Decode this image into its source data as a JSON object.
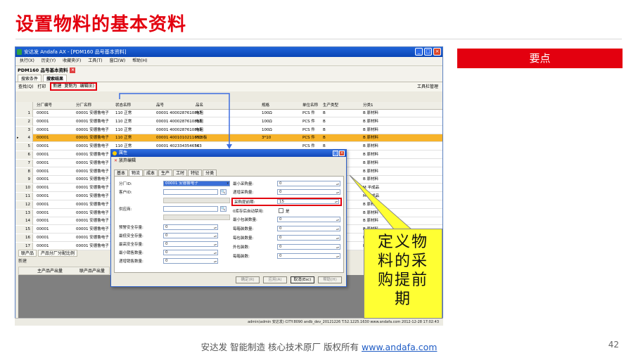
{
  "slide": {
    "title": "设置物料的基本资料",
    "key_points_label": "要点",
    "note": "定义物料的采购提前期",
    "footer_text": "安达发  智能制造 核心技术原厂   版权所有",
    "footer_link": "www.andafa.com",
    "page_number": "42"
  },
  "app": {
    "window_title": "安达发 Andafa AX - [PDM160 品号基本资料]",
    "menu": [
      "执行(X)",
      "历史(Y)",
      "收藏夹(F)",
      "工具(T)",
      "窗口(W)",
      "帮助(H)"
    ],
    "doc_title": "PDM160 品号基本资料",
    "tabs": [
      "搜索条件",
      "搜索结果"
    ],
    "toolbar": {
      "query": "查找(Q)",
      "print": "打印",
      "new": "新建",
      "copy": "复制为",
      "edit": "编辑(E)",
      "tool_manage": "工具栏管理"
    },
    "grid": {
      "columns": [
        "分厂编号",
        "分厂名称",
        "状态名称",
        "品号",
        "品名",
        "规格",
        "单位名称",
        "生产类型",
        "分类1"
      ],
      "rows": [
        [
          "1",
          "00001",
          "00001 安德鲁电子",
          "110 正常",
          "00001 4000287610857",
          "电阻",
          "100Ω",
          "PCS 件",
          "B",
          "B 原材料"
        ],
        [
          "2",
          "00001",
          "00001 安德鲁电子",
          "110 正常",
          "00001 4000287610858",
          "电阻",
          "100Ω",
          "PCS 件",
          "B",
          "B 原材料"
        ],
        [
          "3",
          "00001",
          "00001 安德鲁电子",
          "110 正常",
          "00001 4000287610859",
          "电阻",
          "100Ω",
          "PCS 件",
          "B",
          "B 原材料"
        ],
        [
          "4",
          "00001",
          "00001 安德鲁电子",
          "110 正常",
          "00001 4001010211650",
          "PCB板",
          "3*10",
          "PCS 件",
          "B",
          "B 原材料"
        ],
        [
          "5",
          "00001",
          "00001 安德鲁电子",
          "110 正常",
          "00001 4023343546543",
          "IC",
          "",
          "PCS 件",
          "B",
          "B 原材料"
        ],
        [
          "6",
          "00001",
          "00001 安德鲁电子",
          "",
          "",
          "",
          "",
          "",
          "",
          "B 原材料"
        ],
        [
          "7",
          "00001",
          "00001 安德鲁电子",
          "",
          "",
          "",
          "",
          "",
          "",
          "B 原材料"
        ],
        [
          "8",
          "00001",
          "00001 安德鲁电子",
          "",
          "",
          "",
          "",
          "",
          "",
          "B 原材料"
        ],
        [
          "9",
          "00001",
          "00001 安德鲁电子",
          "",
          "",
          "",
          "",
          "",
          "",
          "B 原材料"
        ],
        [
          "10",
          "00001",
          "00001 安德鲁电子",
          "",
          "",
          "",
          "",
          "",
          "",
          "M 半成品"
        ],
        [
          "11",
          "00001",
          "00001 安德鲁电子",
          "",
          "",
          "",
          "",
          "",
          "",
          "M 半成品"
        ],
        [
          "12",
          "00001",
          "00001 安德鲁电子",
          "",
          "",
          "",
          "",
          "",
          "",
          "B 原材料"
        ],
        [
          "13",
          "00001",
          "00001 安德鲁电子",
          "",
          "",
          "",
          "",
          "",
          "",
          "B 原材料"
        ],
        [
          "14",
          "00001",
          "00001 安德鲁电子",
          "",
          "",
          "",
          "",
          "",
          "",
          "B 原材料"
        ],
        [
          "15",
          "00001",
          "00001 安德鲁电子",
          "",
          "",
          "",
          "",
          "",
          "",
          "B 原材料"
        ],
        [
          "16",
          "00001",
          "00001 安德鲁电子",
          "",
          "",
          "",
          "",
          "",
          "",
          "B 原材料"
        ],
        [
          "17",
          "00001",
          "00001 安德鲁电子",
          "",
          "",
          "",
          "",
          "",
          "",
          "B 原材料"
        ]
      ]
    },
    "subtabs": [
      "联产品",
      "产品分厂分配比例"
    ],
    "subtoolbar": "新建",
    "subgrid_columns": [
      "主产品产出量",
      "联产品产出量"
    ],
    "statusbar": "admin(admin 安达发)  CITY:8090  andb_dev_20121226  T.52.1225.1630  www.andafa.com  2012-12-28 17:02:43"
  },
  "dialog": {
    "title": "属性",
    "toolbar_cancel": "放弃编辑",
    "tabs": [
      "基本",
      "物流",
      "成本",
      "生产",
      "工时",
      "特征",
      "分类"
    ],
    "active_tab": 1,
    "left_fields": [
      {
        "label": "分厂ID:",
        "value": "00001 安德鲁电子"
      },
      {
        "label": "客户ID:",
        "value": ""
      },
      {
        "label": "供应商:",
        "value": ""
      },
      {
        "label": "预警安全存量:",
        "value": "0"
      },
      {
        "label": "最低安全存量:",
        "value": "0"
      },
      {
        "label": "最高安全存量:",
        "value": "0"
      },
      {
        "label": "最小销售数量:",
        "value": "0"
      },
      {
        "label": "递增销售数量:",
        "value": "0"
      }
    ],
    "right_fields": [
      {
        "label": "最小采购量:",
        "value": "0"
      },
      {
        "label": "递增采购量:",
        "value": "0"
      },
      {
        "label": "采购提前期:",
        "value": "15"
      },
      {
        "label": "0库存后自动禁用:",
        "value": "是"
      },
      {
        "label": "最小包装数量:",
        "value": "0"
      },
      {
        "label": "每箱装数量:",
        "value": "0"
      },
      {
        "label": "每包装数量:",
        "value": "0"
      },
      {
        "label": "外包装数:",
        "value": "0"
      },
      {
        "label": "每箱装数:",
        "value": "0"
      }
    ],
    "buttons": [
      "确定(R)",
      "应用(A)",
      "取消(Esc)",
      "帮助(H)"
    ]
  }
}
